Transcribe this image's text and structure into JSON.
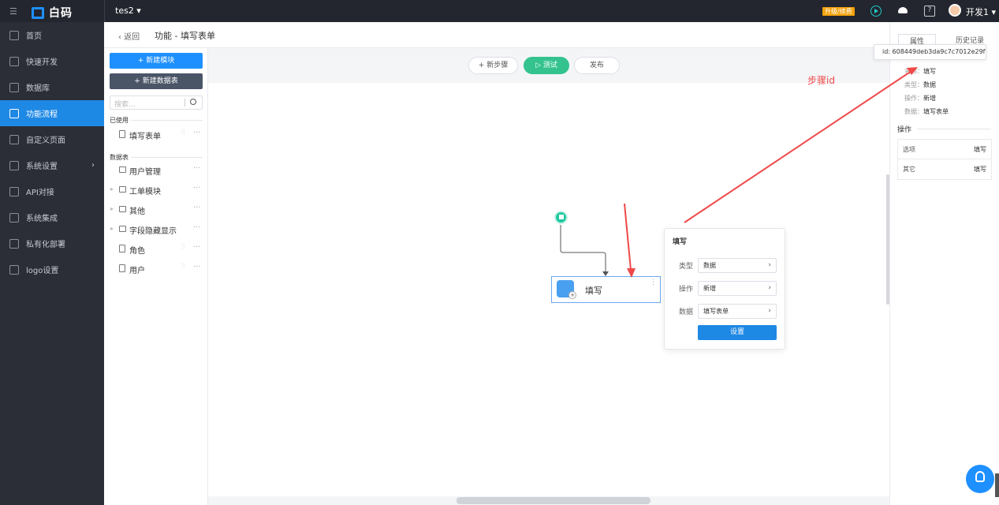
{
  "app": {
    "logo_text": "白码",
    "project": "tes2 ▾",
    "upgrade_badge": "升级/续费",
    "user": "开发1 ▾",
    "help": "?"
  },
  "sidebar": {
    "items": [
      {
        "label": "首页"
      },
      {
        "label": "快速开发"
      },
      {
        "label": "数据库"
      },
      {
        "label": "功能流程"
      },
      {
        "label": "自定义页面"
      },
      {
        "label": "系统设置"
      },
      {
        "label": "API对接"
      },
      {
        "label": "系统集成"
      },
      {
        "label": "私有化部署"
      },
      {
        "label": "logo设置"
      }
    ]
  },
  "header": {
    "back": "‹  返回",
    "title": "功能 - 填写表单"
  },
  "left_panel": {
    "new_module": "+  新建模块",
    "new_table": "+  新建数据表",
    "search_placeholder": "搜索...",
    "used_section": "已使用",
    "used_items": [
      {
        "label": "填写表单"
      }
    ],
    "tables_section": "数据表",
    "table_items": [
      {
        "label": "用户管理"
      },
      {
        "label": "工单模块"
      },
      {
        "label": "其他"
      },
      {
        "label": "字段隐藏显示"
      },
      {
        "label": "角色"
      },
      {
        "label": "用户"
      }
    ]
  },
  "canvas": {
    "new_step": "+ 新步骤",
    "test": "▷ 测试",
    "publish": "发布",
    "node_label": "填写",
    "popup": {
      "title": "填写",
      "rows": [
        {
          "label": "类型",
          "value": "数据"
        },
        {
          "label": "操作",
          "value": "新增"
        },
        {
          "label": "数据",
          "value": "填写表单"
        }
      ],
      "set_button": "设置"
    }
  },
  "right_panel": {
    "tab_props": "属性",
    "tab_history": "历史记录",
    "tooltip": "id: 608449deb3da9c7c7012e29f",
    "props": [
      {
        "key": "名称：",
        "value": "填写"
      },
      {
        "key": "类型：",
        "value": "数据"
      },
      {
        "key": "操作：",
        "value": "新增"
      },
      {
        "key": "数据：",
        "value": "填写表单"
      }
    ],
    "op_section": "操作",
    "op_rows": [
      {
        "key": "选项",
        "value": "填写"
      },
      {
        "key": "其它",
        "value": "填写"
      }
    ]
  },
  "annotation": {
    "text": "步骤id",
    "color": "#f04848"
  }
}
